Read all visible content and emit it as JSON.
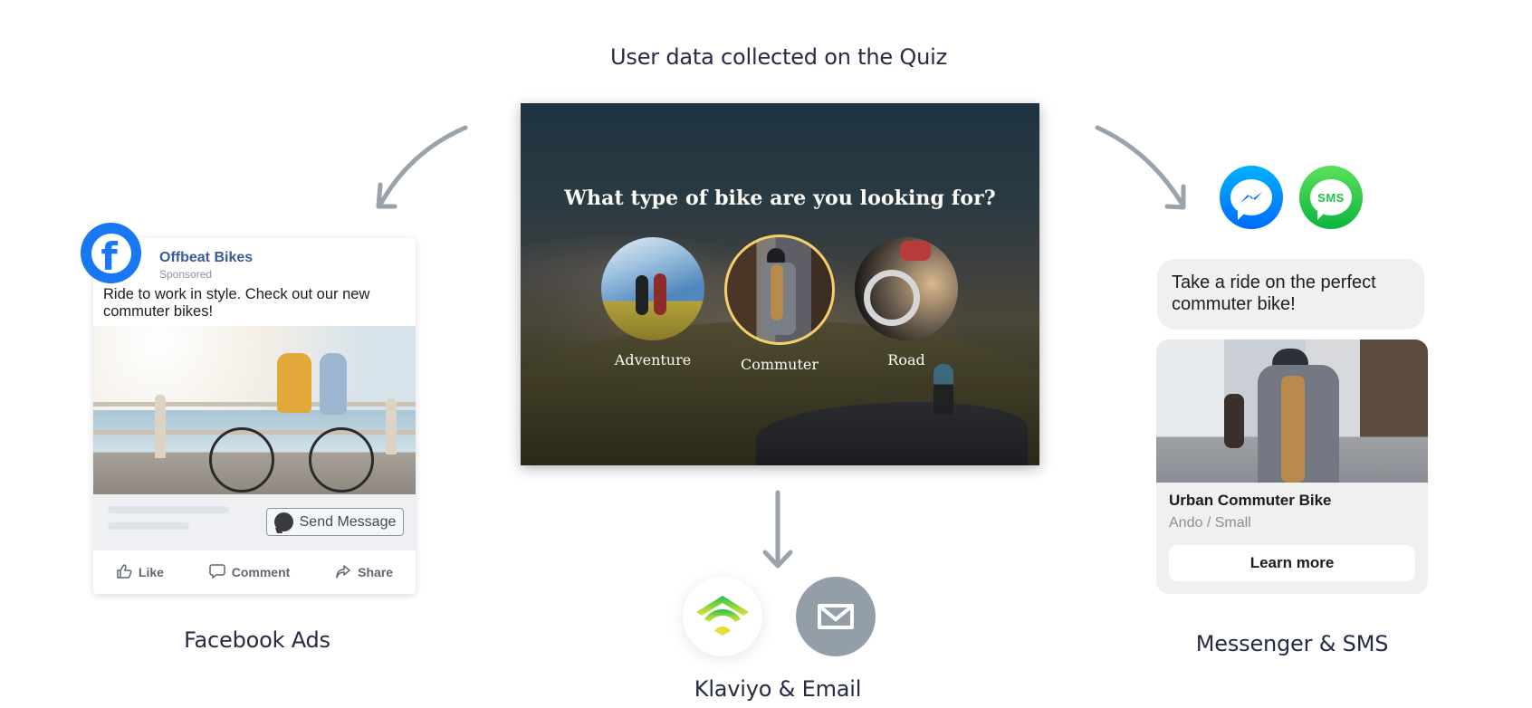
{
  "header": {
    "title": "User data collected on the Quiz"
  },
  "quiz": {
    "question": "What type of bike are you looking for?",
    "options": [
      {
        "label": "Adventure",
        "selected": false
      },
      {
        "label": "Commuter",
        "selected": true
      },
      {
        "label": "Road",
        "selected": false
      }
    ],
    "selected_color": "#f4cf6a"
  },
  "facebook": {
    "caption": "Facebook Ads",
    "page_name": "Offbeat Bikes",
    "sponsored_label": "Sponsored",
    "post_text": "Ride to work in style. Check out our new commuter bikes!",
    "cta_label": "Send Message",
    "actions": {
      "like": "Like",
      "comment": "Comment",
      "share": "Share"
    },
    "brand_color": "#1877f2"
  },
  "email": {
    "caption": "Klaviyo & Email"
  },
  "messaging": {
    "caption": "Messenger & SMS",
    "sms_badge": "SMS",
    "message_text": "Take a ride on the perfect commuter bike!",
    "product_title": "Urban Commuter Bike",
    "product_variant": "Ando / Small",
    "cta_label": "Learn more",
    "messenger_color": "#0084ff",
    "sms_color": "#25c24a"
  },
  "colors": {
    "arrow": "#9aa3ac",
    "caption_text": "#262a44"
  }
}
